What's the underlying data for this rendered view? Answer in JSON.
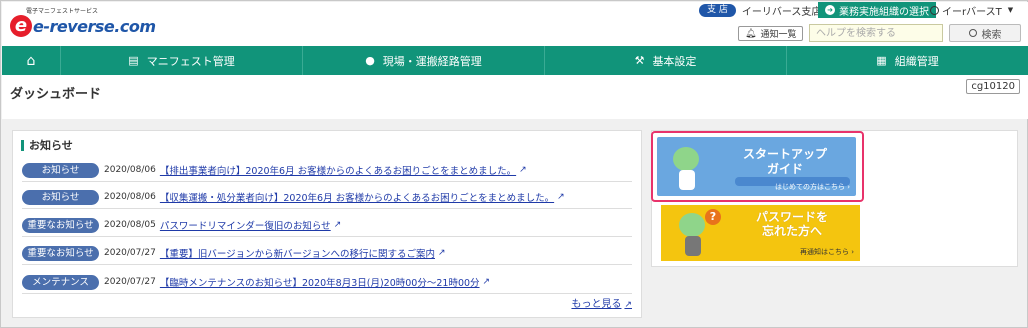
{
  "brand": {
    "tagline": "電子マニフェストサービス",
    "logo_letter": "e",
    "name": "e-reverse.com",
    "accent": "#11947a",
    "primary": "#1f56a8"
  },
  "header": {
    "branch_badge": "支 店",
    "branch_name": "イーリバース支店",
    "org_select_label": "業務実施組織の選択",
    "user_name": "イーrバースT",
    "notice_button": "通知一覧",
    "help_placeholder": "ヘルプを検索する",
    "search_button": "検索"
  },
  "nav": {
    "home_icon": "home-icon",
    "items": [
      {
        "label": "マニフェスト管理",
        "icon": "document-icon"
      },
      {
        "label": "現場・運搬経路管理",
        "icon": "map-pin-icon"
      },
      {
        "label": "基本設定",
        "icon": "wrench-icon"
      },
      {
        "label": "組織管理",
        "icon": "org-icon"
      }
    ]
  },
  "page": {
    "title": "ダッシュボード",
    "code": "cg10120"
  },
  "news": {
    "title": "お知らせ",
    "items": [
      {
        "badge": "お知らせ",
        "date": "2020/08/06",
        "text": "【排出事業者向け】2020年6月 お客様からのよくあるお困りごとをまとめました。"
      },
      {
        "badge": "お知らせ",
        "date": "2020/08/06",
        "text": "【収集運搬・処分業者向け】2020年6月 お客様からのよくあるお困りごとをまとめました。"
      },
      {
        "badge": "重要なお知らせ",
        "date": "2020/08/05",
        "text": "パスワードリマインダー復旧のお知らせ"
      },
      {
        "badge": "重要なお知らせ",
        "date": "2020/07/27",
        "text": "【重要】旧バージョンから新バージョンへの移行に関するご案内"
      },
      {
        "badge": "メンテナンス",
        "date": "2020/07/27",
        "text": "【臨時メンテナンスのお知らせ】2020年8月3日(月)20時00分～21時00分"
      }
    ],
    "more_link": "もっと見る"
  },
  "banners": {
    "startup": {
      "title_line1": "スタートアップ",
      "title_line2": "ガイド",
      "sub": "はじめての方はこちら ›"
    },
    "password": {
      "title_line1": "パスワードを",
      "title_line2": "忘れた方へ",
      "sub": "再通知はこちら ›"
    }
  }
}
